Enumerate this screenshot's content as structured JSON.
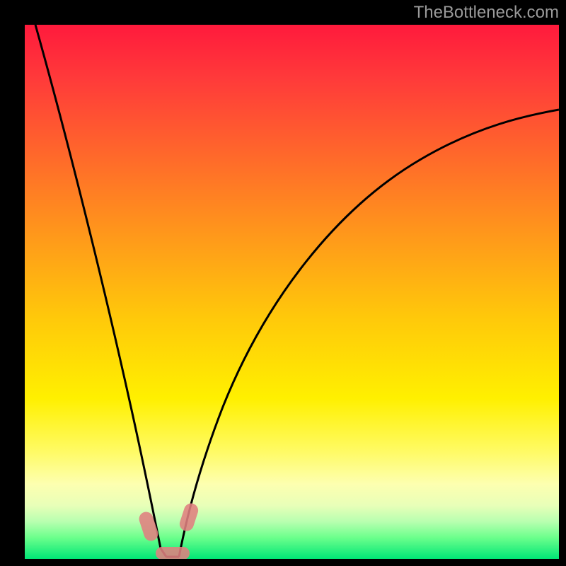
{
  "watermark": {
    "text": "TheBottleneck.com"
  },
  "chart_data": {
    "type": "line",
    "title": "",
    "xlabel": "",
    "ylabel": "",
    "xlim": [
      0,
      100
    ],
    "ylim": [
      0,
      100
    ],
    "gradient_stops": [
      {
        "pct": 0,
        "color": "#ff1a3c"
      },
      {
        "pct": 10,
        "color": "#ff3a3a"
      },
      {
        "pct": 25,
        "color": "#ff6a2a"
      },
      {
        "pct": 40,
        "color": "#ff9a1a"
      },
      {
        "pct": 55,
        "color": "#ffc90a"
      },
      {
        "pct": 70,
        "color": "#fff000"
      },
      {
        "pct": 80,
        "color": "#fffb66"
      },
      {
        "pct": 86,
        "color": "#fdffb0"
      },
      {
        "pct": 90,
        "color": "#e8ffb8"
      },
      {
        "pct": 93,
        "color": "#b8ffb0"
      },
      {
        "pct": 96,
        "color": "#6cff8c"
      },
      {
        "pct": 100,
        "color": "#00e676"
      }
    ],
    "series": [
      {
        "name": "left-branch",
        "x": [
          2,
          5,
          8,
          11,
          14,
          17,
          20,
          22,
          24,
          25
        ],
        "values": [
          100,
          85,
          70,
          56,
          44,
          33,
          22,
          14,
          7,
          1
        ]
      },
      {
        "name": "right-branch",
        "x": [
          29,
          31,
          34,
          38,
          43,
          50,
          58,
          67,
          77,
          88,
          100
        ],
        "values": [
          1,
          7,
          15,
          24,
          34,
          44,
          54,
          63,
          71,
          78,
          84
        ]
      }
    ],
    "markers": [
      {
        "name": "marker-left",
        "x": 22.5,
        "y": 5,
        "w": 3,
        "h": 6,
        "rot": -60
      },
      {
        "name": "marker-right",
        "x": 30.5,
        "y": 7.5,
        "w": 3,
        "h": 6,
        "rot": 30
      },
      {
        "name": "marker-bottom",
        "x": 27,
        "y": 1,
        "w": 6,
        "h": 3,
        "rot": 0
      }
    ]
  }
}
